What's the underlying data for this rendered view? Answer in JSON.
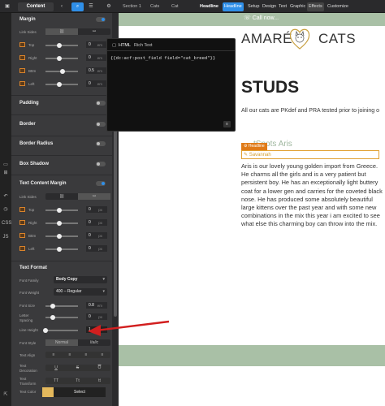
{
  "topbar": {
    "content_tab": "Content",
    "breadcrumbs": [
      "Section 1",
      "Cats",
      "Cat",
      "Headline"
    ],
    "right_tabs": [
      "Headline",
      "Setup",
      "Design",
      "Text",
      "Graphic",
      "Effects",
      "Customize"
    ]
  },
  "panel": {
    "margin": {
      "title": "Margin",
      "link_sides": "Link Sides",
      "sides": [
        {
          "label": "Top",
          "value": "0",
          "unit": "em"
        },
        {
          "label": "Right",
          "value": "0",
          "unit": "em"
        },
        {
          "label": "Bttm",
          "value": "0.5",
          "unit": "em"
        },
        {
          "label": "Left",
          "value": "0",
          "unit": "em"
        }
      ]
    },
    "padding_title": "Padding",
    "border_title": "Border",
    "border_radius_title": "Border Radius",
    "box_shadow_title": "Box Shadow",
    "text_content_margin": {
      "title": "Text Content Margin",
      "link_sides": "Link Sides",
      "sides": [
        {
          "label": "Top",
          "value": "0",
          "unit": "px"
        },
        {
          "label": "Right",
          "value": "0",
          "unit": "px"
        },
        {
          "label": "Bttm",
          "value": "0",
          "unit": "px"
        },
        {
          "label": "Left",
          "value": "0",
          "unit": "px"
        }
      ]
    },
    "text_format": {
      "title": "Text Format",
      "font_family_label": "Font Family",
      "font_family_value": "Body Copy",
      "font_weight_label": "Font Weight",
      "font_weight_value": "400 – Regular",
      "font_size_label": "Font Size",
      "font_size_value": "0.8",
      "font_size_unit": "em",
      "letter_spacing_label": "Letter Spacing",
      "letter_spacing_value": "0",
      "letter_spacing_unit": "px",
      "line_height_label": "Line Height",
      "line_height_value": "1",
      "font_style_label": "Font Style",
      "font_style_options": [
        "Normal",
        "Italic"
      ],
      "text_align_label": "Text Align",
      "text_decoration_label": "Text Decoration",
      "text_transform_label": "Text Transform",
      "text_color_label": "Text Color",
      "select_label": "Select"
    }
  },
  "strip": {
    "css": "CSS",
    "js": "JS"
  },
  "popup": {
    "tabs": [
      "HTML",
      "Rich Text"
    ],
    "code": "{{dc:acf:post_field field=\"cat_breed\"}}"
  },
  "canvas": {
    "call_now": "Call now...",
    "logo_left": "AMARÉ",
    "logo_right": "CATS",
    "heading": "STUDS",
    "intro": "All our cats are PKdef and PRA tested prior to joining o",
    "headline_badge": "Headline",
    "cat_name_suffix": "tSpots Aris",
    "breed": "Savannah",
    "bio": "Aris is our lovely young golden import from Greece. He charms all the girls and is a very patient but persistent boy. He has an exceptionally light buttery coat for a lower gen and carries for the coveted black nose. He has produced some absolutely beautiful large kittens over the past year and with some new combinations in the mix this year i am excited to see what else this charming boy can throw into the mix."
  },
  "colors": {
    "accent": "#2f8fe8",
    "highlight": "#e07b18",
    "green": "#a9c0a6",
    "swatch": "#e3b85c",
    "arrow": "#d21f1f"
  }
}
